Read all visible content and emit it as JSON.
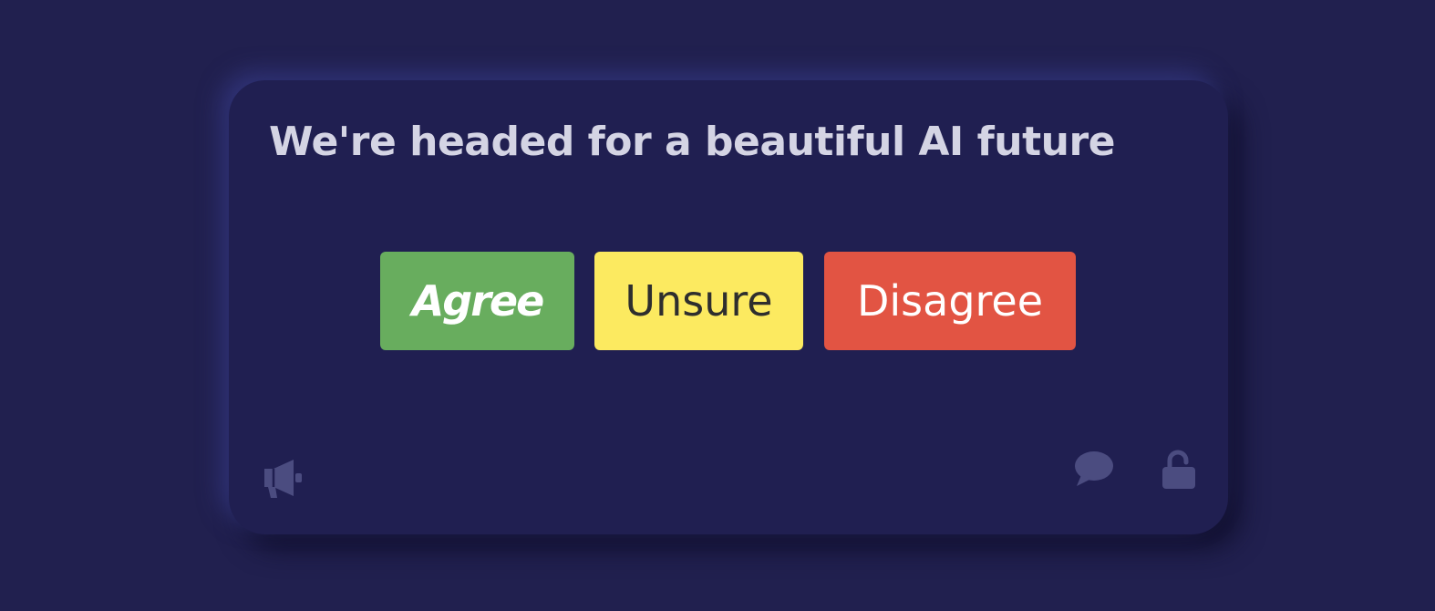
{
  "card": {
    "title": "We're headed for a beautiful AI future"
  },
  "buttons": {
    "agree": "Agree",
    "unsure": "Unsure",
    "disagree": "Disagree"
  },
  "icons": {
    "megaphone": "megaphone-icon",
    "comment": "comment-icon",
    "lock": "unlock-icon"
  },
  "colors": {
    "background": "#21204f",
    "card": "#201f51",
    "title": "#d4d4e4",
    "agree": "#68ad5e",
    "unsure": "#fcea60",
    "disagree": "#e25443",
    "icon": "#4b4c80"
  }
}
